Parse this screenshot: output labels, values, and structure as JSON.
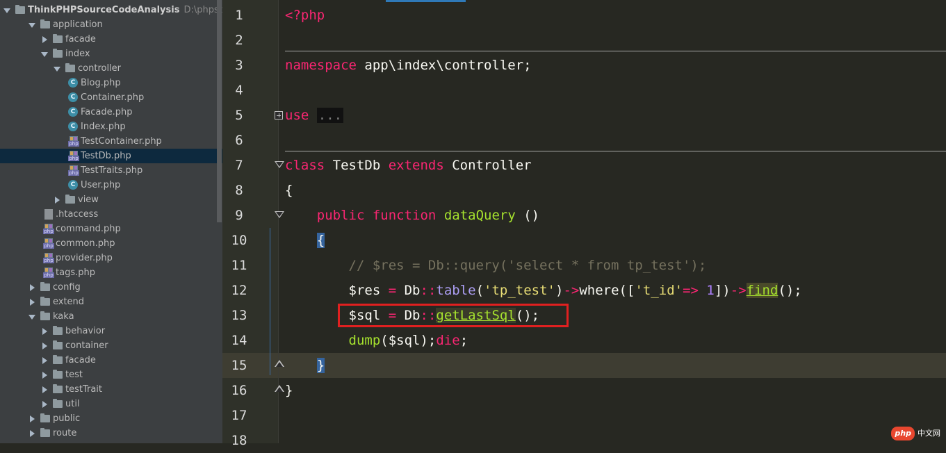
{
  "project": {
    "name": "ThinkPHPSourceCodeAnalysis",
    "path": "D:\\phpstudy_pr"
  },
  "tree": [
    {
      "label": "application",
      "type": "folder",
      "state": "open",
      "depth": 1
    },
    {
      "label": "facade",
      "type": "folder",
      "state": "closed",
      "depth": 2
    },
    {
      "label": "index",
      "type": "folder",
      "state": "open",
      "depth": 2
    },
    {
      "label": "controller",
      "type": "folder",
      "state": "open",
      "depth": 3
    },
    {
      "label": "Blog.php",
      "type": "class",
      "depth": 4
    },
    {
      "label": "Container.php",
      "type": "class",
      "depth": 4
    },
    {
      "label": "Facade.php",
      "type": "class",
      "depth": 4
    },
    {
      "label": "Index.php",
      "type": "class",
      "depth": 4
    },
    {
      "label": "TestContainer.php",
      "type": "php",
      "depth": 4
    },
    {
      "label": "TestDb.php",
      "type": "php",
      "depth": 4,
      "selected": true
    },
    {
      "label": "TestTraits.php",
      "type": "php",
      "depth": 4
    },
    {
      "label": "User.php",
      "type": "class",
      "depth": 4
    },
    {
      "label": "view",
      "type": "folder",
      "state": "closed",
      "depth": 3
    },
    {
      "label": ".htaccess",
      "type": "file",
      "depth": 2
    },
    {
      "label": "command.php",
      "type": "php",
      "depth": 2
    },
    {
      "label": "common.php",
      "type": "php",
      "depth": 2
    },
    {
      "label": "provider.php",
      "type": "php",
      "depth": 2
    },
    {
      "label": "tags.php",
      "type": "php",
      "depth": 2
    },
    {
      "label": "config",
      "type": "folder",
      "state": "closed",
      "depth": 1
    },
    {
      "label": "extend",
      "type": "folder",
      "state": "closed",
      "depth": 1
    },
    {
      "label": "kaka",
      "type": "folder",
      "state": "open",
      "depth": 1
    },
    {
      "label": "behavior",
      "type": "folder",
      "state": "closed",
      "depth": 2
    },
    {
      "label": "container",
      "type": "folder",
      "state": "closed",
      "depth": 2
    },
    {
      "label": "facade",
      "type": "folder",
      "state": "closed",
      "depth": 2
    },
    {
      "label": "test",
      "type": "folder",
      "state": "closed",
      "depth": 2
    },
    {
      "label": "testTrait",
      "type": "folder",
      "state": "closed",
      "depth": 2
    },
    {
      "label": "util",
      "type": "folder",
      "state": "closed",
      "depth": 2
    },
    {
      "label": "public",
      "type": "folder",
      "state": "closed",
      "depth": 1
    },
    {
      "label": "route",
      "type": "folder",
      "state": "closed",
      "depth": 1
    }
  ],
  "lines": [
    "1",
    "2",
    "3",
    "4",
    "5",
    "6",
    "7",
    "8",
    "9",
    "10",
    "11",
    "12",
    "13",
    "14",
    "15",
    "16",
    "17",
    "18"
  ],
  "code": {
    "l1": "<?php",
    "l3_kw": "namespace",
    "l3_rest": " app\\index\\controller;",
    "l5_kw": "use",
    "l5_fold": "...",
    "l8_class": "class",
    "l8_name": " TestDb ",
    "l8_extends": "extends",
    "l8_parent": " Controller",
    "l9": "{",
    "l10_indent": "    ",
    "l10_public": "public",
    "l10_function": "function",
    "l10_name": "dataQuery",
    "l10_parens": " ()",
    "l11_indent": "    ",
    "l11_brace": "{",
    "l12": "        // $res = Db::query('select * from tp_test');",
    "l13_a": "        $res ",
    "l13_eq": "=",
    "l13_b": " Db",
    "l13_dc": "::",
    "l13_table": "table",
    "l13_p1": "(",
    "l13_str": "'tp_test'",
    "l13_p2": ")",
    "l13_arrow1": "->",
    "l13_where": "where",
    "l13_p3": "([",
    "l13_str2": "'t_id'",
    "l13_fat": "=>",
    "l13_num": " 1",
    "l13_p4": "])",
    "l13_arrow2": "->",
    "l13_find": "find",
    "l13_end": "();",
    "l14_a": "        $sql ",
    "l14_eq": "=",
    "l14_b": " Db",
    "l14_dc": "::",
    "l14_fn": "getLastSql",
    "l14_end": "();",
    "l15_a": "        ",
    "l15_dump": "dump",
    "l15_b": "($sql);",
    "l15_die": "die",
    "l15_end": ";",
    "l16_indent": "    ",
    "l16_brace": "}",
    "l17": "}"
  },
  "watermark": {
    "logo": "php",
    "text": "中文网"
  }
}
